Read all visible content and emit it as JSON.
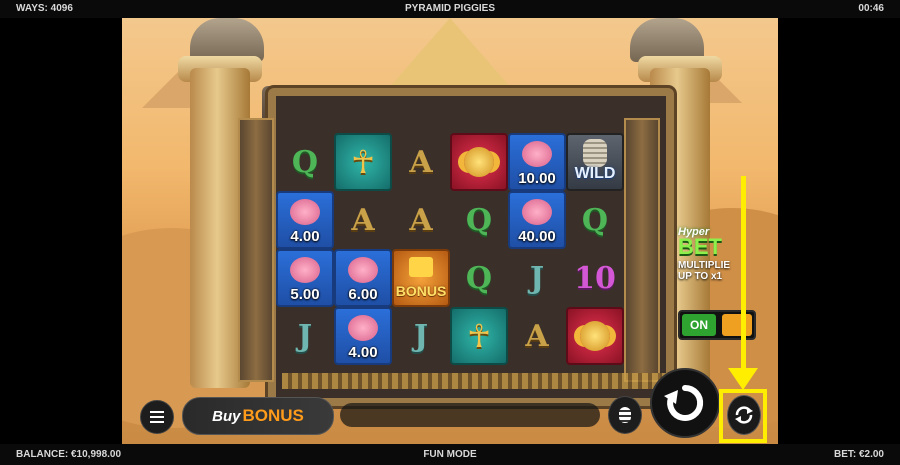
{
  "status_bar": {
    "ways": "WAYS: 4096",
    "title": "PYRAMID PIGGIES",
    "time": "00:46"
  },
  "footer": {
    "balance": "BALANCE: €10,998.00",
    "mode": "FUN MODE",
    "bet": "BET: €2.00"
  },
  "reels": [
    [
      {
        "symbol": "Q"
      },
      {
        "symbol": "pig",
        "value": "4.00"
      },
      {
        "symbol": "pig",
        "value": "5.00"
      },
      {
        "symbol": "J"
      }
    ],
    [
      {
        "symbol": "ankh"
      },
      {
        "symbol": "A"
      },
      {
        "symbol": "pig",
        "value": "6.00"
      },
      {
        "symbol": "pig",
        "value": "4.00"
      }
    ],
    [
      {
        "symbol": "A"
      },
      {
        "symbol": "A"
      },
      {
        "symbol": "bonus",
        "label": "BONUS"
      },
      {
        "symbol": "J"
      }
    ],
    [
      {
        "symbol": "scarab"
      },
      {
        "symbol": "Q"
      },
      {
        "symbol": "Q"
      },
      {
        "symbol": "ankh"
      }
    ],
    [
      {
        "symbol": "pig",
        "value": "10.00"
      },
      {
        "symbol": "pig",
        "value": "40.00"
      },
      {
        "symbol": "J"
      },
      {
        "symbol": "A"
      }
    ],
    [
      {
        "symbol": "wild",
        "label": "WILD"
      },
      {
        "symbol": "Q"
      },
      {
        "symbol": "10"
      },
      {
        "symbol": "scarab"
      }
    ]
  ],
  "hyper_bet": {
    "logo": "Hyper",
    "title": "BET",
    "multiplier_line1": "MULTIPLIE",
    "multiplier_line2": "UP TO x1",
    "toggle_label": "ON"
  },
  "controls": {
    "buy_label": "Buy",
    "bonus_label": "BONUS",
    "menu_icon": "hamburger-menu-icon",
    "stake_icon": "coin-stack-icon",
    "spin_icon": "spin-arrow-icon",
    "autoplay_icon": "autoplay-refresh-icon"
  },
  "annotation": {
    "color": "#ffee00",
    "target": "autoplay-button"
  }
}
